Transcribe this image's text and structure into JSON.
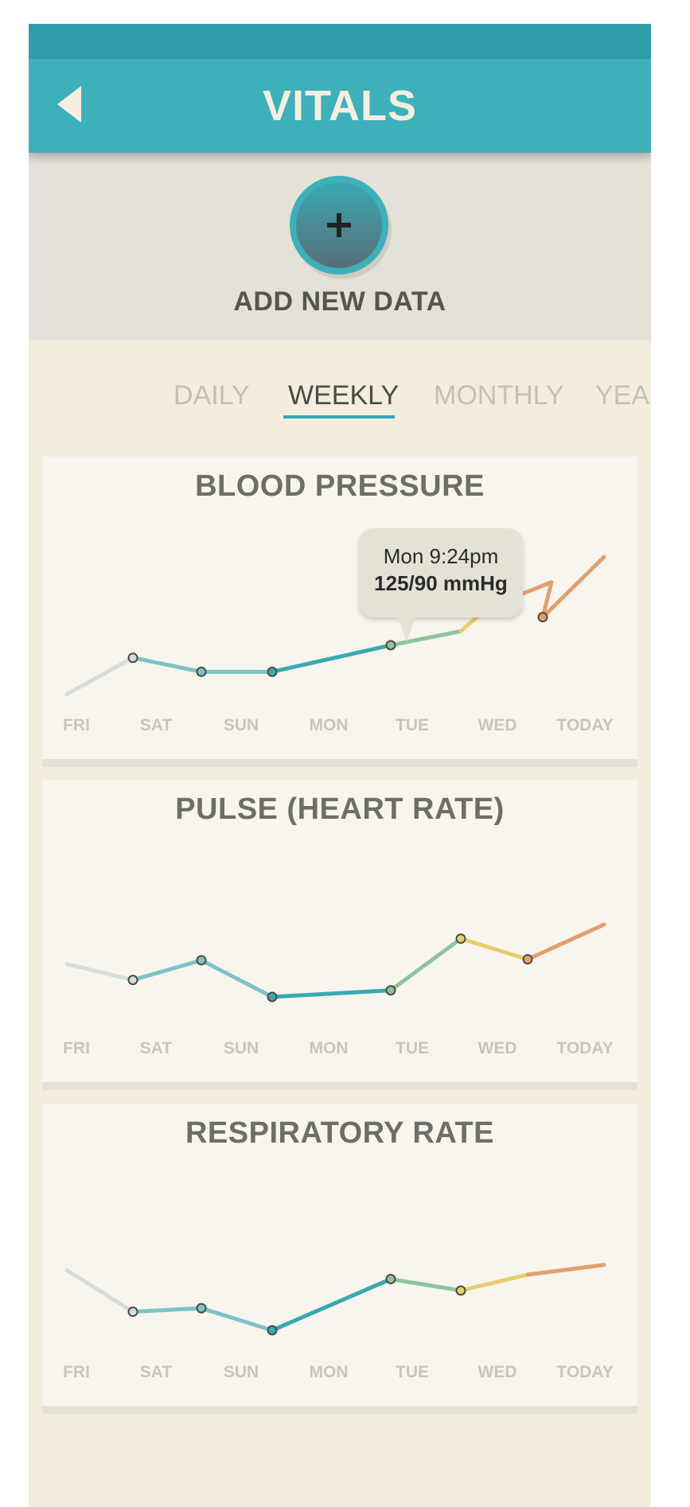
{
  "header": {
    "title": "VITALS",
    "back_icon": "chevron-left-icon"
  },
  "add": {
    "icon": "plus-icon",
    "label": "ADD NEW DATA"
  },
  "tabs": [
    {
      "label": "DAILY",
      "active": false
    },
    {
      "label": "WEEKLY",
      "active": true
    },
    {
      "label": "MONTHLY",
      "active": false
    },
    {
      "label": "YEARLY",
      "active": false
    }
  ],
  "colors": {
    "accent": "#3db0ba",
    "line_gradient": [
      "#d6ddd9",
      "#7ec3c6",
      "#3aa9b2",
      "#8fc3a0",
      "#e6cf6c",
      "#e39f6f",
      "#cf5b4a"
    ]
  },
  "tooltip": {
    "time": "Mon 9:24pm",
    "value": "125/90 mmHg"
  },
  "chart_data": [
    {
      "type": "line",
      "title": "BLOOD PRESSURE",
      "categories": [
        "FRI",
        "SAT",
        "SUN",
        "MON",
        "TUE",
        "WED",
        "TODAY"
      ],
      "values": [
        0.02,
        0.28,
        0.18,
        0.18,
        0.37,
        0.47,
        0.64,
        0.82,
        0.57,
        1.0
      ],
      "point_markers": [
        false,
        true,
        true,
        true,
        true,
        false,
        false,
        false,
        true,
        false
      ],
      "y_units": "relative"
    },
    {
      "type": "line",
      "title": "PULSE (HEART RATE)",
      "categories": [
        "FRI",
        "SAT",
        "SUN",
        "MON",
        "TUE",
        "WED",
        "TODAY"
      ],
      "values": [
        0.58,
        0.41,
        0.62,
        0.23,
        0.3,
        0.85,
        0.63,
        1.0
      ],
      "point_markers": [
        false,
        true,
        true,
        true,
        true,
        true,
        true,
        false
      ],
      "y_units": "relative"
    },
    {
      "type": "line",
      "title": "RESPIRATORY RATE",
      "categories": [
        "FRI",
        "SAT",
        "SUN",
        "MON",
        "TUE",
        "WED",
        "TODAY"
      ],
      "values": [
        0.78,
        0.31,
        0.35,
        0.1,
        0.68,
        0.55,
        0.73,
        0.84
      ],
      "point_markers": [
        false,
        true,
        true,
        true,
        true,
        true,
        false,
        false
      ],
      "y_units": "relative"
    }
  ]
}
